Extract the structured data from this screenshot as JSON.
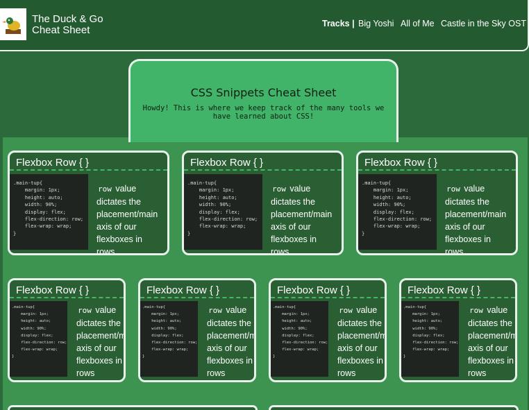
{
  "header": {
    "site_title": "The Duck & Go Cheat Sheet",
    "nav": {
      "tracks_label": "Tracks |",
      "links": [
        "Big Yoshi",
        "All of Me",
        "Castle in the Sky OST"
      ]
    }
  },
  "hero": {
    "title": "CSS Snippets Cheat Sheet",
    "subtitle": "Howdy! This is where we keep track of the many tools we have learned about CSS!"
  },
  "cards": [
    {
      "title": "Flexbox Row { }",
      "code": ".main-tup{\n    margin: 1px;\n    height: auto;\n    width: 90%;\n    display: flex;\n    flex-direction: row;\n    flex-wrap: wrap;\n}",
      "keyword": "row",
      "desc": " value dictates the placement/main axis of our flexboxes in rows"
    },
    {
      "title": "Flexbox Row { }",
      "code": ".main-tup{\n    margin: 1px;\n    height: auto;\n    width: 90%;\n    display: flex;\n    flex-direction: row;\n    flex-wrap: wrap;\n}",
      "keyword": "row",
      "desc": " value dictates the placement/main axis of our flexboxes in rows"
    },
    {
      "title": "Flexbox Row { }",
      "code": ".main-tup{\n    margin: 1px;\n    height: auto;\n    width: 90%;\n    display: flex;\n    flex-direction: row;\n    flex-wrap: wrap;\n}",
      "keyword": "row",
      "desc": " value dictates the placement/main axis of our flexboxes in rows"
    },
    {
      "title": "Flexbox Row { }",
      "code": ".main-tup{\n    margin: 1px;\n    height: auto;\n    width: 90%;\n    display: flex;\n    flex-direction: row;\n    flex-wrap: wrap;\n}",
      "keyword": "row",
      "desc": " value dictates the placement/main axis of our flexboxes in rows"
    },
    {
      "title": "Flexbox Row { }",
      "code": ".main-tup{\n    margin: 1px;\n    height: auto;\n    width: 90%;\n    display: flex;\n    flex-direction: row;\n    flex-wrap: wrap;\n}",
      "keyword": "row",
      "desc": " value dictates the placement/main axis of our flexboxes in rows"
    },
    {
      "title": "Flexbox Row { }",
      "code": ".main-tup{\n    margin: 1px;\n    height: auto;\n    width: 90%;\n    display: flex;\n    flex-direction: row;\n    flex-wrap: wrap;\n}",
      "keyword": "row",
      "desc": " value dictates the placement/main axis of our flexboxes in rows"
    },
    {
      "title": "Flexbox Row { }",
      "code": ".main-tup{\n    margin: 1px;\n    height: auto;\n    width: 90%;\n    display: flex;\n    flex-direction: row;\n    flex-wrap: wrap;\n}",
      "keyword": "row",
      "desc": " value dictates the placement/main axis of our flexboxes in rows"
    }
  ],
  "colors": {
    "page_bg": "#2c6a3c",
    "header_bg": "#245a30",
    "hero_bg": "#42b46a",
    "panel_bg": "#3d9350",
    "card_bg": "#2a5f34",
    "code_bg": "#1f2421",
    "border": "#e9f1ec"
  },
  "icons": {
    "logo": "duck-logo-icon"
  }
}
